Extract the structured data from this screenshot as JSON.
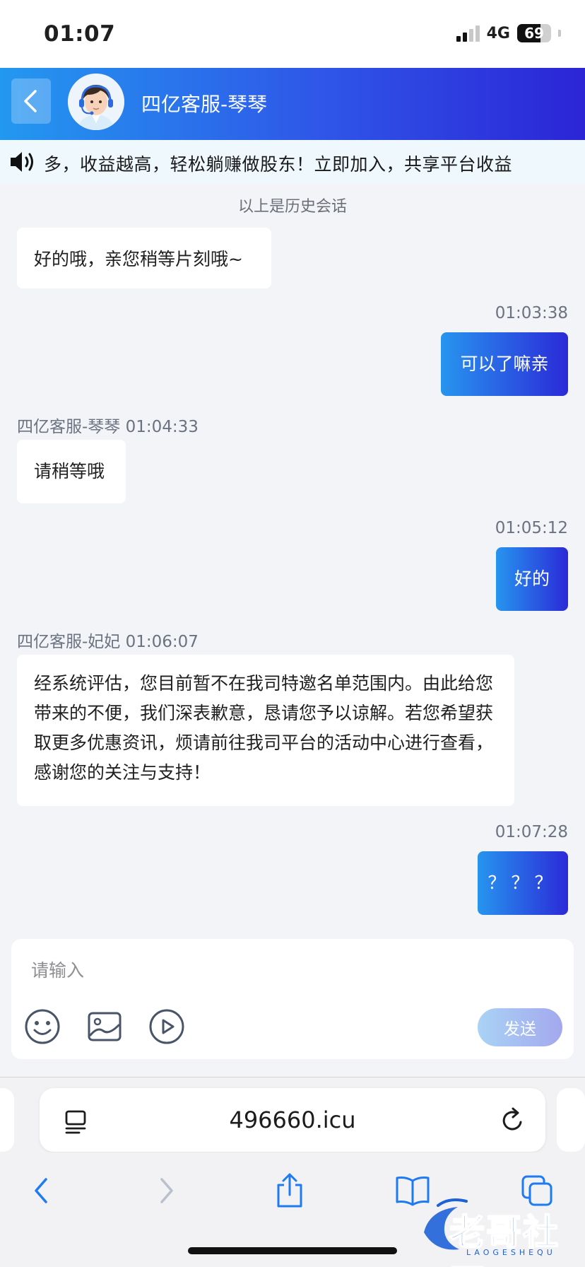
{
  "status_bar": {
    "time": "01:07",
    "network": "4G",
    "battery": "69",
    "battery_level": 0.69
  },
  "header": {
    "agent_name": "四亿客服-琴琴"
  },
  "notice": {
    "text": "多，收益越高，轻松躺赚做股东！立即加入，共享平台收益"
  },
  "chat": {
    "history_label": "以上是历史会话",
    "messages": [
      {
        "side": "in",
        "meta": "",
        "text": "好的哦，亲您稍等片刻哦~"
      },
      {
        "side": "out",
        "meta": "01:03:38",
        "text": "可以了嘛亲"
      },
      {
        "side": "in",
        "meta": "四亿客服-琴琴 01:04:33",
        "text": "请稍等哦"
      },
      {
        "side": "out",
        "meta": "01:05:12",
        "text": "好的"
      },
      {
        "side": "in",
        "meta": "四亿客服-妃妃 01:06:07",
        "text": "经系统评估，您目前暂不在我司特邀名单范围内。由此给您带来的不便，我们深表歉意，恳请您予以谅解。若您希望获取更多优惠资讯，烦请前往我司平台的活动中心进行查看，感谢您的关注与支持！"
      },
      {
        "side": "out",
        "meta": "01:07:28",
        "text": "？？？"
      }
    ]
  },
  "composer": {
    "placeholder": "请输入",
    "send_label": "发送"
  },
  "browser": {
    "url": "496660.icu"
  },
  "watermark": {
    "text": "老哥社区",
    "subtext": "LAOGESHEQU"
  },
  "colors": {
    "accent_start": "#2398f0",
    "accent_end": "#2b25d6",
    "chat_bg": "#f3f4f8"
  }
}
